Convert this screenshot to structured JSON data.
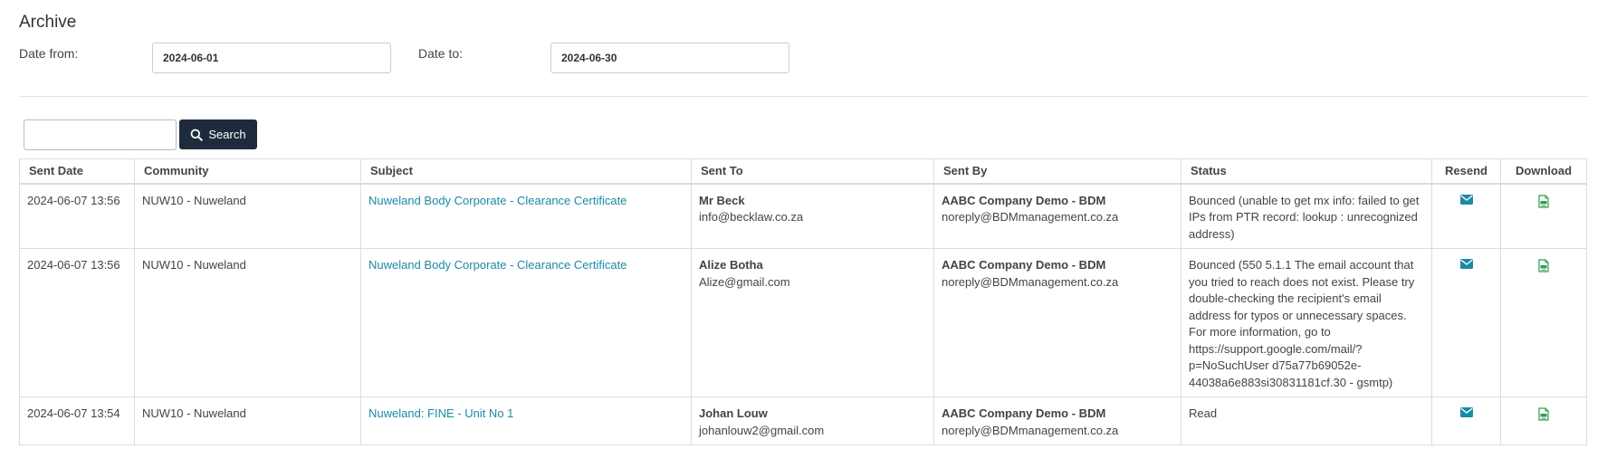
{
  "page": {
    "title": "Archive"
  },
  "filters": {
    "date_from_label": "Date from:",
    "date_from_value": "2024-06-01",
    "date_to_label": "Date to:",
    "date_to_value": "2024-06-30"
  },
  "search": {
    "value": "",
    "button_label": "Search",
    "icon": "search-icon"
  },
  "table": {
    "headers": [
      "Sent Date",
      "Community",
      "Subject",
      "Sent To",
      "Sent By",
      "Status",
      "Resend",
      "Download"
    ],
    "rows": [
      {
        "sent_date": "2024-06-07 13:56",
        "community": "NUW10 - Nuweland",
        "subject": "Nuweland Body Corporate - Clearance Certificate",
        "sent_to_name": "Mr Beck",
        "sent_to_email": "info@becklaw.co.za",
        "sent_by_name": "AABC Company Demo - BDM",
        "sent_by_email": "noreply@BDMmanagement.co.za",
        "status": "Bounced (unable to get mx info: failed to get IPs from PTR record: lookup : unrecognized address)"
      },
      {
        "sent_date": "2024-06-07 13:56",
        "community": "NUW10 - Nuweland",
        "subject": "Nuweland Body Corporate - Clearance Certificate",
        "sent_to_name": "Alize Botha",
        "sent_to_email": "Alize@gmail.com",
        "sent_by_name": "AABC Company Demo - BDM",
        "sent_by_email": "noreply@BDMmanagement.co.za",
        "status": "Bounced (550 5.1.1 The email account that you tried to reach does not exist. Please try double-checking the recipient's email address for typos or unnecessary spaces. For more information, go to https://support.google.com/mail/?p=NoSuchUser d75a77b69052e-44038a6e883si30831181cf.30 - gsmtp)"
      },
      {
        "sent_date": "2024-06-07 13:54",
        "community": "NUW10 - Nuweland",
        "subject": "Nuweland: FINE - Unit No 1",
        "sent_to_name": "Johan Louw",
        "sent_to_email": "johanlouw2@gmail.com",
        "sent_by_name": "AABC Company Demo - BDM",
        "sent_by_email": "noreply@BDMmanagement.co.za",
        "status": "Read"
      }
    ]
  },
  "icons": {
    "resend": "envelope-icon",
    "download": "pdf-download-icon"
  },
  "colors": {
    "primary_button": "#1f2b3d",
    "link": "#1b8aa6",
    "resend_icon": "#1b8aa6",
    "download_icon": "#2e9e4f"
  }
}
